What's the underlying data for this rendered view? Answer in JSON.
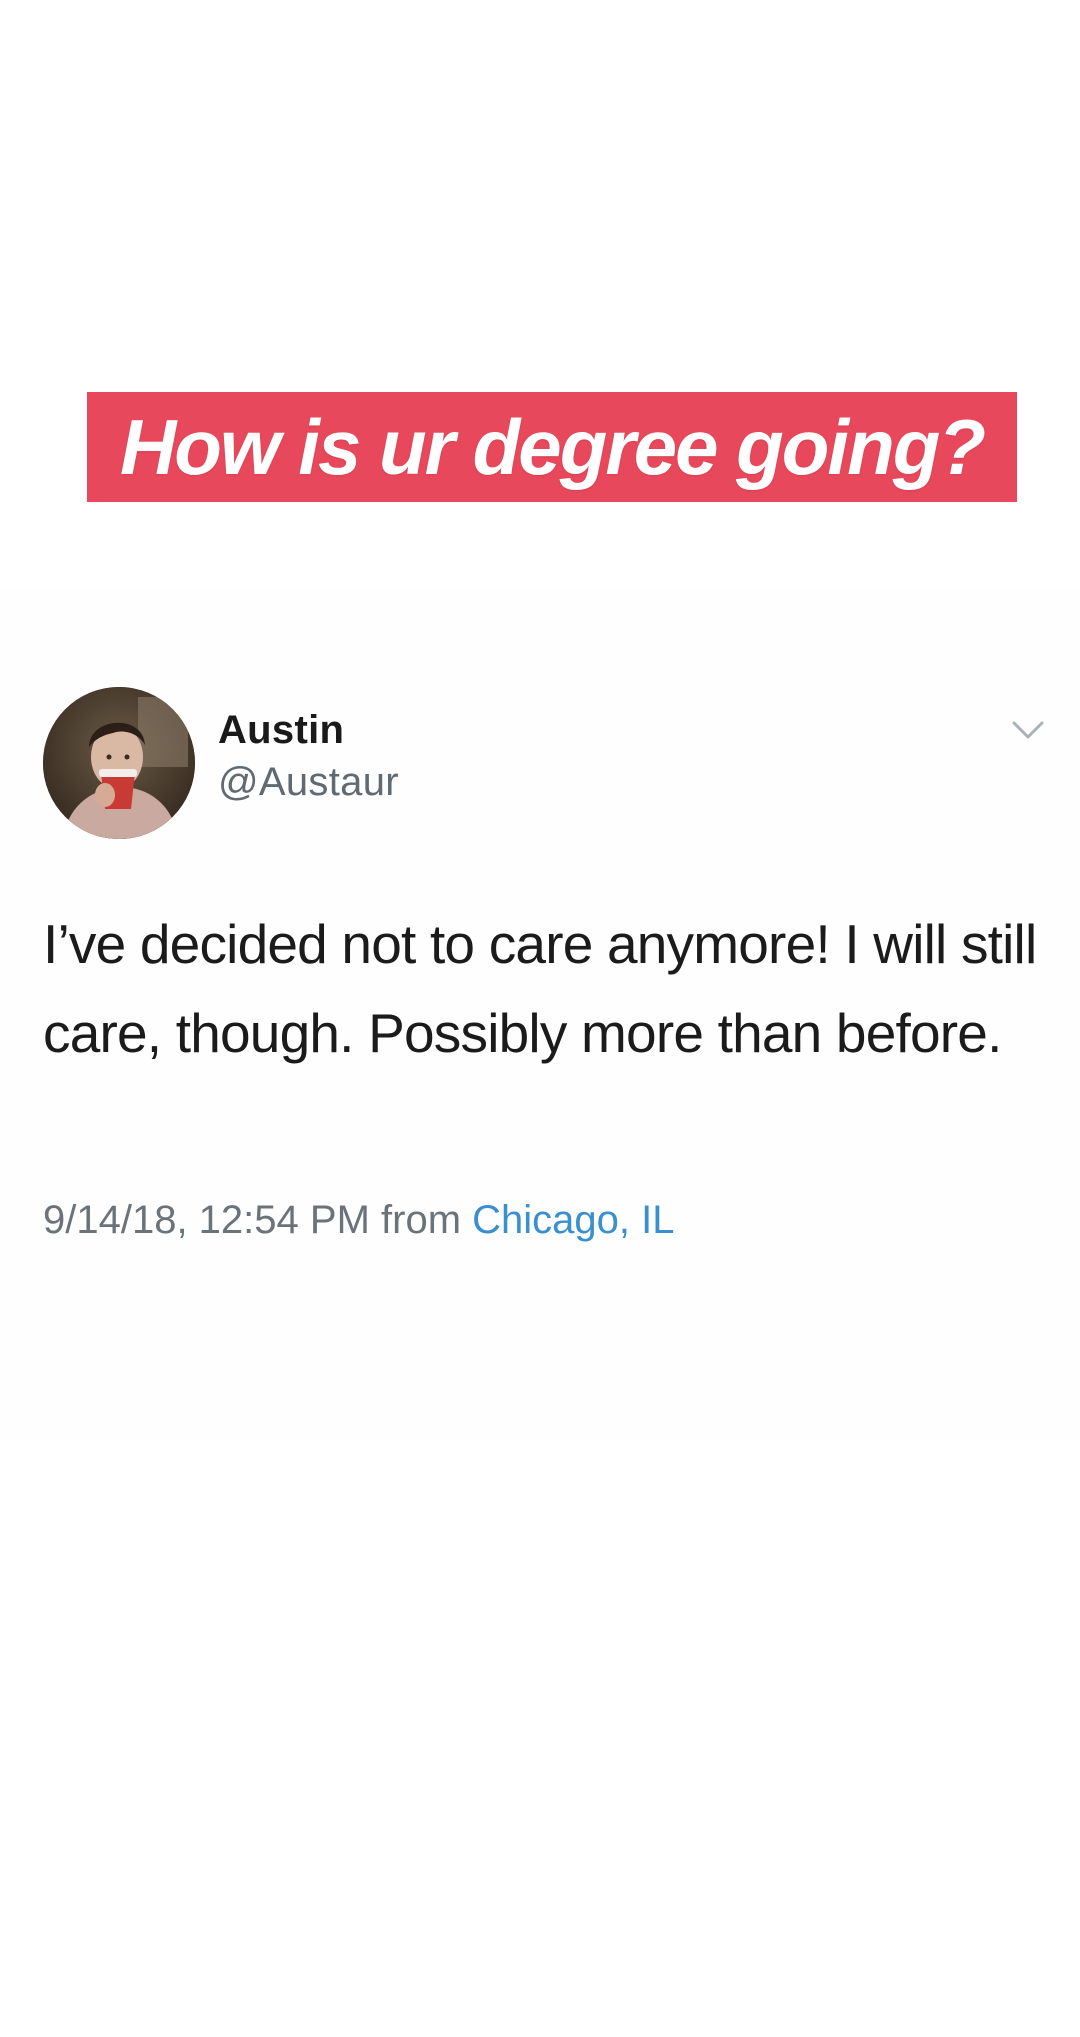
{
  "caption": {
    "text": "How is ur degree going?",
    "background_color": "#e8485b",
    "text_color": "#ffffff"
  },
  "tweet": {
    "display_name": "Austin",
    "handle": "@Austaur",
    "text": "I’ve decided not to care anymore! I will still care, though. Possibly more than before.",
    "timestamp": "9/14/18, 12:54 PM",
    "from_label": "from",
    "location": "Chicago, IL",
    "location_color": "#3a8fcf",
    "avatar_icon": "user-avatar-photo",
    "menu_icon": "chevron-down-icon"
  }
}
